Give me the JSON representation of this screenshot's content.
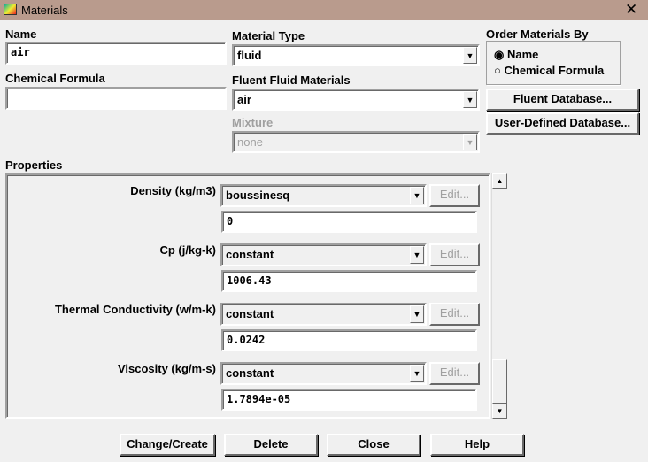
{
  "window": {
    "title": "Materials"
  },
  "name": {
    "label": "Name",
    "value": "air"
  },
  "chemical_formula": {
    "label": "Chemical Formula",
    "value": ""
  },
  "material_type": {
    "label": "Material Type",
    "value": "fluid"
  },
  "fluent_materials": {
    "label": "Fluent Fluid Materials",
    "value": "air"
  },
  "mixture": {
    "label": "Mixture",
    "value": "none"
  },
  "order_by": {
    "label": "Order Materials By",
    "options": [
      "Name",
      "Chemical Formula"
    ],
    "selected": "Name"
  },
  "buttons": {
    "fluent_db": "Fluent Database...",
    "user_db": "User-Defined Database...",
    "change": "Change/Create",
    "delete": "Delete",
    "close": "Close",
    "help": "Help"
  },
  "properties": {
    "label": "Properties",
    "edit_label": "Edit...",
    "items": [
      {
        "label": "Density (kg/m3)",
        "method": "boussinesq",
        "value": "0"
      },
      {
        "label": "Cp (j/kg-k)",
        "method": "constant",
        "value": "1006.43"
      },
      {
        "label": "Thermal Conductivity (w/m-k)",
        "method": "constant",
        "value": "0.0242"
      },
      {
        "label": "Viscosity (kg/m-s)",
        "method": "constant",
        "value": "1.7894e-05"
      }
    ]
  }
}
